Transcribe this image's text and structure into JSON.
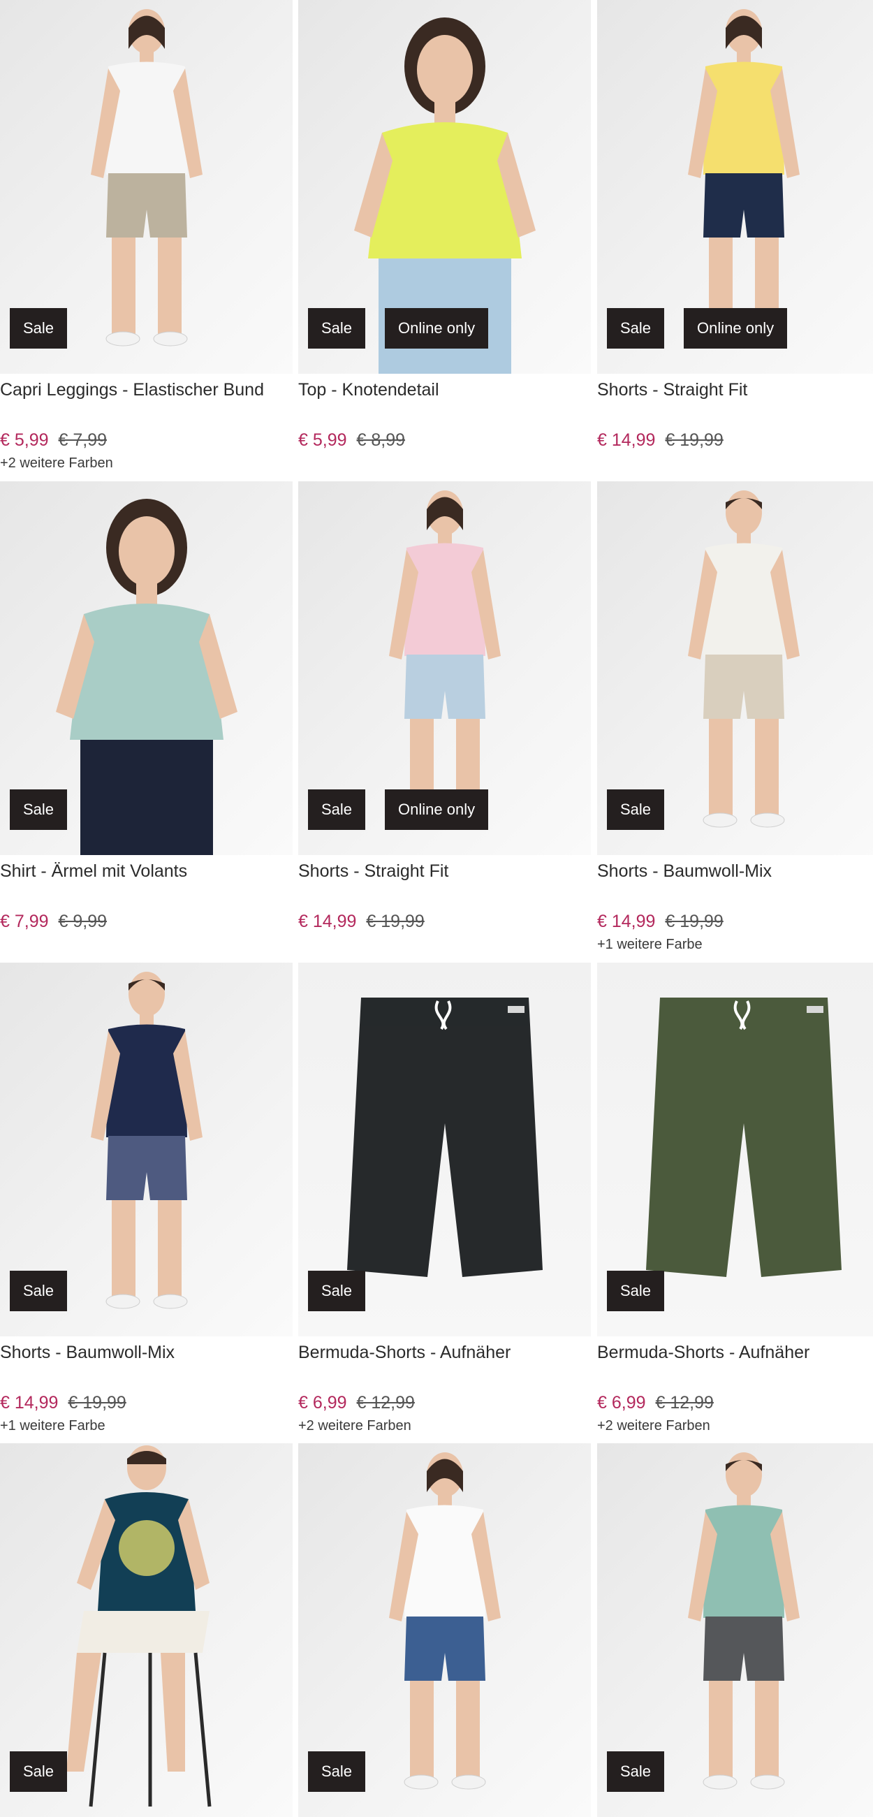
{
  "products": [
    {
      "title": "Capri Leggings - Elastischer Bund",
      "price": "€ 5,99",
      "old_price": "€ 7,99",
      "colors": "+2 weitere Farben",
      "badges": [
        "Sale"
      ],
      "figure": "woman",
      "top": "#f6f6f6",
      "bottom": "#bcb29e"
    },
    {
      "title": "Top - Knotendetail",
      "price": "€ 5,99",
      "old_price": "€ 8,99",
      "colors": "",
      "badges": [
        "Sale",
        "Online only"
      ],
      "figure": "woman-close",
      "top": "#e4ee5c",
      "bottom": "#aecbe0"
    },
    {
      "title": "Shorts - Straight Fit",
      "price": "€ 14,99",
      "old_price": "€ 19,99",
      "colors": "",
      "badges": [
        "Sale",
        "Online only"
      ],
      "figure": "woman",
      "top": "#f5df6e",
      "bottom": "#1f2d4a"
    },
    {
      "title": "Shirt - Ärmel mit Volants",
      "price": "€ 7,99",
      "old_price": "€ 9,99",
      "colors": "",
      "badges": [
        "Sale"
      ],
      "figure": "woman-close",
      "top": "#a9cdc6",
      "bottom": "#1d2438"
    },
    {
      "title": "Shorts - Straight Fit",
      "price": "€ 14,99",
      "old_price": "€ 19,99",
      "colors": "",
      "badges": [
        "Sale",
        "Online only"
      ],
      "figure": "woman",
      "top": "#f3cbd6",
      "bottom": "#b9cfe0"
    },
    {
      "title": "Shorts - Baumwoll-Mix",
      "price": "€ 14,99",
      "old_price": "€ 19,99",
      "colors": "+1 weitere Farbe",
      "badges": [
        "Sale"
      ],
      "figure": "man",
      "top": "#f2f1ec",
      "bottom": "#d9cfbe"
    },
    {
      "title": "Shorts - Baumwoll-Mix",
      "price": "€ 14,99",
      "old_price": "€ 19,99",
      "colors": "+1 weitere Farbe",
      "badges": [
        "Sale"
      ],
      "figure": "man",
      "top": "#1f2a4c",
      "bottom": "#4e5a80"
    },
    {
      "title": "Bermuda-Shorts - Aufnäher",
      "price": "€ 6,99",
      "old_price": "€ 12,99",
      "colors": "+2 weitere Farben",
      "badges": [
        "Sale"
      ],
      "figure": "shorts",
      "top": "",
      "bottom": "#26292b"
    },
    {
      "title": "Bermuda-Shorts - Aufnäher",
      "price": "€ 6,99",
      "old_price": "€ 12,99",
      "colors": "+2 weitere Farben",
      "badges": [
        "Sale"
      ],
      "figure": "shorts",
      "top": "",
      "bottom": "#4b5a3c"
    },
    {
      "title": "",
      "price": "",
      "old_price": "",
      "colors": "",
      "badges": [
        "Sale"
      ],
      "figure": "man-sitting",
      "top": "#123f55",
      "bottom": "#f1ede4"
    },
    {
      "title": "",
      "price": "",
      "old_price": "",
      "colors": "",
      "badges": [
        "Sale"
      ],
      "figure": "woman",
      "top": "#fafafa",
      "bottom": "#3c5f92"
    },
    {
      "title": "",
      "price": "",
      "old_price": "",
      "colors": "",
      "badges": [
        "Sale"
      ],
      "figure": "man",
      "top": "#8fbfb2",
      "bottom": "#55575a"
    }
  ],
  "colors": {
    "price": "#b3285c",
    "badge_bg": "#241f1f",
    "badge_text": "#ffffff"
  }
}
